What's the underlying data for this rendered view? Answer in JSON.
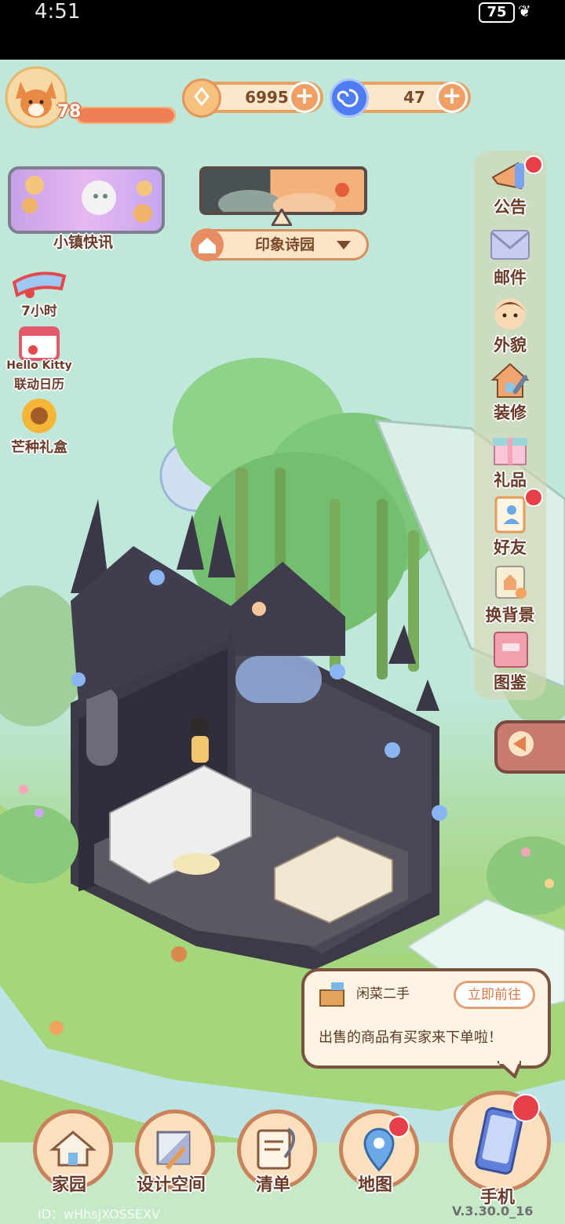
{
  "status_bar": {
    "time": "4:51",
    "battery": "75"
  },
  "player": {
    "level": "78",
    "level_progress": 1.0
  },
  "currencies": [
    {
      "icon": "coin-icon",
      "value": "6995"
    },
    {
      "icon": "swirl-gem-icon",
      "value": "47"
    }
  ],
  "news": {
    "label": "小镇快讯"
  },
  "location": {
    "name": "印象诗园"
  },
  "events": [
    {
      "icon": "goggles-icon",
      "label": "7小时"
    },
    {
      "icon": "calendar-icon",
      "brand": "Hello Kitty",
      "label": "联动日历"
    },
    {
      "icon": "sunflower-icon",
      "label": "芒种礼盒"
    }
  ],
  "sidebar": {
    "items": [
      {
        "icon": "megaphone-icon",
        "label": "公告",
        "badge": true
      },
      {
        "icon": "envelope-icon",
        "label": "邮件",
        "badge": false
      },
      {
        "icon": "avatar-face-icon",
        "label": "外貌",
        "badge": false
      },
      {
        "icon": "house-wrench-icon",
        "label": "装修",
        "badge": false
      },
      {
        "icon": "gift-box-icon",
        "label": "礼品",
        "badge": false
      },
      {
        "icon": "contacts-icon",
        "label": "好友",
        "badge": true
      },
      {
        "icon": "picture-swap-icon",
        "label": "换背景",
        "badge": false
      },
      {
        "icon": "album-icon",
        "label": "图鉴",
        "badge": false
      }
    ]
  },
  "notification": {
    "title": "闲菜二手",
    "action": "立即前往",
    "message": "出售的商品有买家来下单啦！"
  },
  "bottom_nav": [
    {
      "icon": "house-icon",
      "label": "家园",
      "badge": false
    },
    {
      "icon": "design-ruler-icon",
      "label": "设计空间",
      "badge": false
    },
    {
      "icon": "list-quill-icon",
      "label": "清单",
      "badge": false
    },
    {
      "icon": "map-pin-icon",
      "label": "地图",
      "badge": true
    },
    {
      "icon": "phone-icon",
      "label": "手机",
      "badge": true
    }
  ],
  "footer": {
    "id": "ID：wHhsjXOSSEXV",
    "version": "V.3.30.0_16"
  },
  "colors": {
    "label_text": "#6b3b2a",
    "accent_orange": "#f1a065",
    "badge_red": "#e8404a",
    "sky": "#bfe7da",
    "grass": "#96c96f"
  }
}
